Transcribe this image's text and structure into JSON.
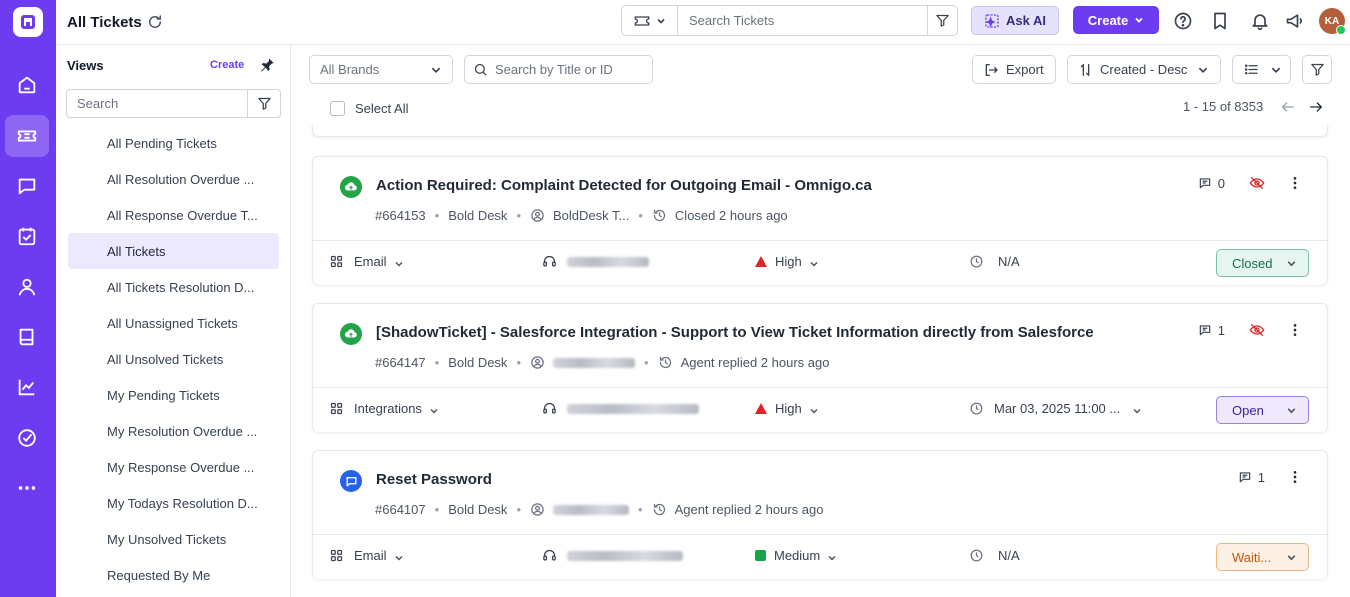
{
  "header": {
    "title": "All Tickets",
    "search_placeholder": "Search Tickets",
    "ask_ai_label": "Ask AI",
    "create_label": "Create",
    "avatar_initials": "KA"
  },
  "rail": {
    "items": [
      "home-icon",
      "tickets-icon",
      "chat-icon",
      "tasks-icon",
      "contacts-icon",
      "knowledge-base-icon",
      "reports-icon",
      "approvals-icon",
      "more-icon"
    ],
    "active": "tickets-icon"
  },
  "views": {
    "title": "Views",
    "create_label": "Create",
    "search_placeholder": "Search",
    "items": [
      "All Pending Tickets",
      "All Resolution Overdue ...",
      "All Response Overdue T...",
      "All Tickets",
      "All Tickets Resolution D...",
      "All Unassigned Tickets",
      "All Unsolved Tickets",
      "My Pending Tickets",
      "My Resolution Overdue ...",
      "My Response Overdue ...",
      "My Todays Resolution D...",
      "My Unsolved Tickets",
      "Requested By Me"
    ],
    "active_index": 3
  },
  "toolbar": {
    "brands_label": "All Brands",
    "search_placeholder": "Search by Title or ID",
    "export_label": "Export",
    "sort_label": "Created - Desc",
    "select_all_label": "Select All",
    "pager_text": "1 - 15 of 8353"
  },
  "colors": {
    "brand": "#6d3cf1",
    "source_green": "#22a447",
    "source_blue": "#2563eb",
    "high_priority": "#dc2626",
    "medium_priority": "#16a34a"
  },
  "tickets": [
    {
      "source": "cloud-icon",
      "title": "Action Required: Complaint Detected for Outgoing Email - Omnigo.ca",
      "id": "#664153",
      "brand": "Bold Desk",
      "requester": "BoldDesk T...",
      "activity": "Closed 2 hours ago",
      "comments": "0",
      "category": "Email",
      "priority": "High",
      "due": "N/A",
      "status": "Closed"
    },
    {
      "source": "cloud-icon",
      "title": "[ShadowTicket] - Salesforce Integration - Support to View Ticket Information directly from Salesforce",
      "id": "#664147",
      "brand": "Bold Desk",
      "requester": "",
      "activity": "Agent replied 2 hours ago",
      "comments": "1",
      "category": "Integrations",
      "priority": "High",
      "due": "Mar 03, 2025 11:00 ...",
      "status": "Open"
    },
    {
      "source": "chat-bubble-icon",
      "title": "Reset Password",
      "id": "#664107",
      "brand": "Bold Desk",
      "requester": "",
      "activity": "Agent replied 2 hours ago",
      "comments": "1",
      "category": "Email",
      "priority": "Medium",
      "due": "N/A",
      "status": "Waiti..."
    }
  ]
}
